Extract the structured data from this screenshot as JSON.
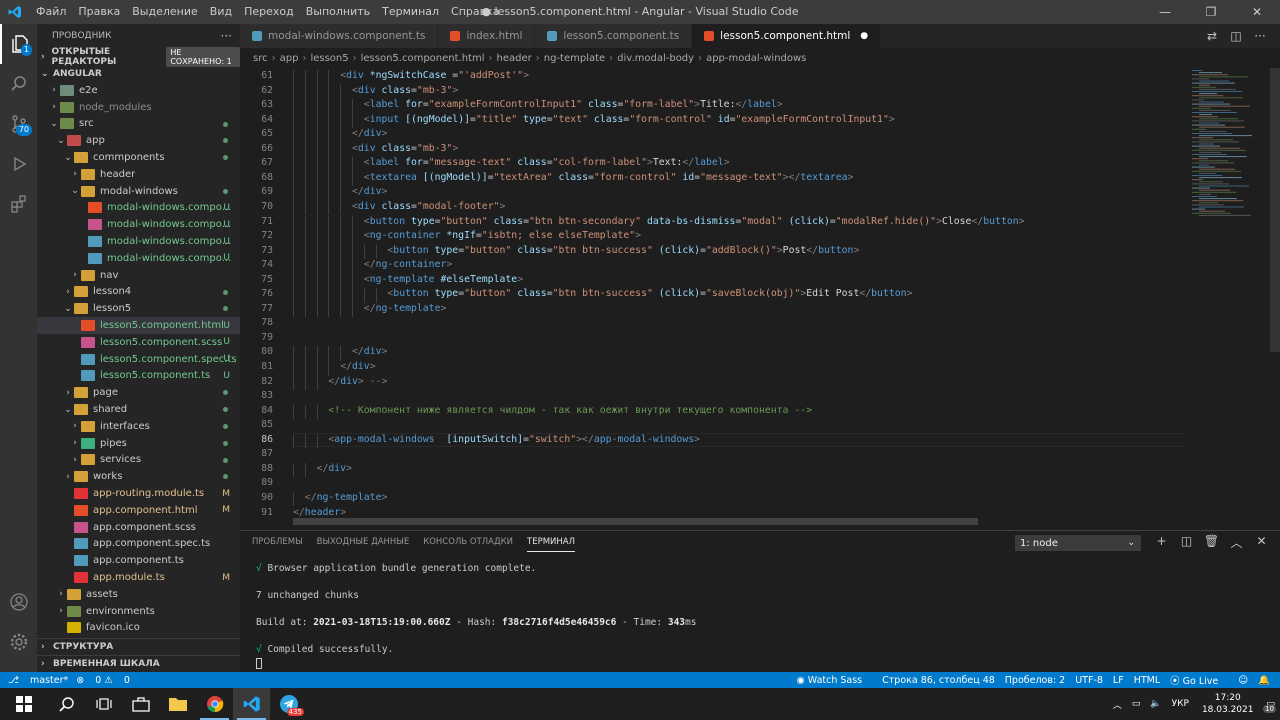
{
  "titlebar": {
    "menu": [
      "Файл",
      "Правка",
      "Выделение",
      "Вид",
      "Переход",
      "Выполнить",
      "Терминал",
      "Справка"
    ],
    "title": "● lesson5.component.html - Angular - Visual Studio Code"
  },
  "activity": {
    "badge_count": "70",
    "explorer_badge": "1"
  },
  "sidebar": {
    "header": "ПРОВОДНИК",
    "open_editors": "ОТКРЫТЫЕ РЕДАКТОРЫ",
    "unsaved": "НЕ СОХРАНЕНО: 1",
    "root": "ANGULAR",
    "items": [
      {
        "label": "e2e",
        "indent": 1,
        "chev": "›",
        "icon": "#6f8b7a",
        "status": ""
      },
      {
        "label": "node_modules",
        "indent": 1,
        "chev": "›",
        "icon": "#6f8b4a",
        "status": "",
        "dim": true
      },
      {
        "label": "src",
        "indent": 1,
        "chev": "⌄",
        "icon": "#6f8b4a",
        "status": "dot"
      },
      {
        "label": "app",
        "indent": 2,
        "chev": "⌄",
        "icon": "#c14b4b",
        "status": "dot"
      },
      {
        "label": "commponents",
        "indent": 3,
        "chev": "⌄",
        "icon": "#d4a038",
        "status": "dot"
      },
      {
        "label": "header",
        "indent": 4,
        "chev": "›",
        "icon": "#d4a038",
        "status": ""
      },
      {
        "label": "modal-windows",
        "indent": 4,
        "chev": "⌄",
        "icon": "#d4a038",
        "status": "dot"
      },
      {
        "label": "modal-windows.compo...",
        "indent": 5,
        "chev": "",
        "icon": "#e44d26",
        "status": "U"
      },
      {
        "label": "modal-windows.compo...",
        "indent": 5,
        "chev": "",
        "icon": "#c6538c",
        "status": "U"
      },
      {
        "label": "modal-windows.compo...",
        "indent": 5,
        "chev": "",
        "icon": "#519aba",
        "status": "U"
      },
      {
        "label": "modal-windows.compo...",
        "indent": 5,
        "chev": "",
        "icon": "#519aba",
        "status": "U"
      },
      {
        "label": "nav",
        "indent": 4,
        "chev": "›",
        "icon": "#d4a038",
        "status": ""
      },
      {
        "label": "lesson4",
        "indent": 3,
        "chev": "›",
        "icon": "#d4a038",
        "status": "dot"
      },
      {
        "label": "lesson5",
        "indent": 3,
        "chev": "⌄",
        "icon": "#d4a038",
        "status": "dot"
      },
      {
        "label": "lesson5.component.html",
        "indent": 4,
        "chev": "",
        "icon": "#e44d26",
        "status": "U",
        "sel": true
      },
      {
        "label": "lesson5.component.scss",
        "indent": 4,
        "chev": "",
        "icon": "#c6538c",
        "status": "U"
      },
      {
        "label": "lesson5.component.spec.ts",
        "indent": 4,
        "chev": "",
        "icon": "#519aba",
        "status": "U"
      },
      {
        "label": "lesson5.component.ts",
        "indent": 4,
        "chev": "",
        "icon": "#519aba",
        "status": "U"
      },
      {
        "label": "page",
        "indent": 3,
        "chev": "›",
        "icon": "#d4a038",
        "status": "dot"
      },
      {
        "label": "shared",
        "indent": 3,
        "chev": "⌄",
        "icon": "#d4a038",
        "status": "dot"
      },
      {
        "label": "interfaces",
        "indent": 4,
        "chev": "›",
        "icon": "#d4a038",
        "status": "dot"
      },
      {
        "label": "pipes",
        "indent": 4,
        "chev": "›",
        "icon": "#3fb07f",
        "status": "dot"
      },
      {
        "label": "services",
        "indent": 4,
        "chev": "›",
        "icon": "#d4a038",
        "status": "dot"
      },
      {
        "label": "works",
        "indent": 3,
        "chev": "›",
        "icon": "#d4a038",
        "status": "dot"
      },
      {
        "label": "app-routing.module.ts",
        "indent": 3,
        "chev": "",
        "icon": "#e23237",
        "status": "M"
      },
      {
        "label": "app.component.html",
        "indent": 3,
        "chev": "",
        "icon": "#e44d26",
        "status": "M"
      },
      {
        "label": "app.component.scss",
        "indent": 3,
        "chev": "",
        "icon": "#c6538c",
        "status": ""
      },
      {
        "label": "app.component.spec.ts",
        "indent": 3,
        "chev": "",
        "icon": "#519aba",
        "status": ""
      },
      {
        "label": "app.component.ts",
        "indent": 3,
        "chev": "",
        "icon": "#519aba",
        "status": ""
      },
      {
        "label": "app.module.ts",
        "indent": 3,
        "chev": "",
        "icon": "#e23237",
        "status": "M"
      },
      {
        "label": "assets",
        "indent": 2,
        "chev": "›",
        "icon": "#d4a038",
        "status": ""
      },
      {
        "label": "environments",
        "indent": 2,
        "chev": "›",
        "icon": "#6f8b4a",
        "status": ""
      },
      {
        "label": "favicon.ico",
        "indent": 2,
        "chev": "",
        "icon": "#d4b000",
        "status": ""
      }
    ],
    "outline": "СТРУКТУРА",
    "timeline": "ВРЕМЕННАЯ ШКАЛА"
  },
  "tabs": [
    {
      "label": "modal-windows.component.ts",
      "icon": "#519aba",
      "active": false
    },
    {
      "label": "index.html",
      "icon": "#e44d26",
      "active": false
    },
    {
      "label": "lesson5.component.ts",
      "icon": "#519aba",
      "active": false
    },
    {
      "label": "lesson5.component.html",
      "icon": "#e44d26",
      "active": true
    }
  ],
  "breadcrumb": [
    "src",
    "app",
    "lesson5",
    "lesson5.component.html",
    "header",
    "ng-template",
    "div.modal-body",
    "app-modal-windows"
  ],
  "code": {
    "current_line": 86,
    "lines": [
      {
        "n": 61,
        "i": 3,
        "h": "<span class='p'>&lt;</span><span class='t'>div</span> <span class='a'>*ngSwitchCase</span> <span class='w'>=</span><span class='s'>\"'addPost'\"</span><span class='p'>&gt;</span>"
      },
      {
        "n": 62,
        "i": 4,
        "h": "<span class='p'>&lt;</span><span class='t'>div</span> <span class='a'>class</span><span class='w'>=</span><span class='s'>\"mb-3\"</span><span class='p'>&gt;</span>"
      },
      {
        "n": 63,
        "i": 5,
        "h": "<span class='p'>&lt;</span><span class='t'>label</span> <span class='a'>for</span><span class='w'>=</span><span class='s'>\"exampleFormControlInput1\"</span> <span class='a'>class</span><span class='w'>=</span><span class='s'>\"form-label\"</span><span class='p'>&gt;</span><span class='w'>Title:</span><span class='p'>&lt;/</span><span class='t'>label</span><span class='p'>&gt;</span>"
      },
      {
        "n": 64,
        "i": 5,
        "h": "<span class='p'>&lt;</span><span class='t'>input</span> <span class='a'>[(ngModel)]</span><span class='w'>=</span><span class='s'>\"title\"</span> <span class='a'>type</span><span class='w'>=</span><span class='s'>\"text\"</span> <span class='a'>class</span><span class='w'>=</span><span class='s'>\"form-control\"</span> <span class='a'>id</span><span class='w'>=</span><span class='s'>\"exampleFormControlInput1\"</span><span class='p'>&gt;</span>"
      },
      {
        "n": 65,
        "i": 4,
        "h": "<span class='p'>&lt;/</span><span class='t'>div</span><span class='p'>&gt;</span>"
      },
      {
        "n": 66,
        "i": 4,
        "h": "<span class='p'>&lt;</span><span class='t'>div</span> <span class='a'>class</span><span class='w'>=</span><span class='s'>\"mb-3\"</span><span class='p'>&gt;</span>"
      },
      {
        "n": 67,
        "i": 5,
        "h": "<span class='p'>&lt;</span><span class='t'>label</span> <span class='a'>for</span><span class='w'>=</span><span class='s'>\"message-text\"</span> <span class='a'>class</span><span class='w'>=</span><span class='s'>\"col-form-label\"</span><span class='p'>&gt;</span><span class='w'>Text:</span><span class='p'>&lt;/</span><span class='t'>label</span><span class='p'>&gt;</span>"
      },
      {
        "n": 68,
        "i": 5,
        "h": "<span class='p'>&lt;</span><span class='t'>textarea</span> <span class='a'>[(ngModel)]</span><span class='w'>=</span><span class='s'>\"textArea\"</span> <span class='a'>class</span><span class='w'>=</span><span class='s'>\"form-control\"</span> <span class='a'>id</span><span class='w'>=</span><span class='s'>\"message-text\"</span><span class='p'>&gt;&lt;/</span><span class='t'>textarea</span><span class='p'>&gt;</span>"
      },
      {
        "n": 69,
        "i": 4,
        "h": "<span class='p'>&lt;/</span><span class='t'>div</span><span class='p'>&gt;</span>"
      },
      {
        "n": 70,
        "i": 4,
        "h": "<span class='p'>&lt;</span><span class='t'>div</span> <span class='a'>class</span><span class='w'>=</span><span class='s'>\"modal-footer\"</span><span class='p'>&gt;</span>"
      },
      {
        "n": 71,
        "i": 5,
        "h": "<span class='p'>&lt;</span><span class='t'>button</span> <span class='a'>type</span><span class='w'>=</span><span class='s'>\"button\"</span> <span class='a'>class</span><span class='w'>=</span><span class='s'>\"btn btn-secondary\"</span> <span class='a'>data-bs-dismiss</span><span class='w'>=</span><span class='s'>\"modal\"</span> <span class='a'>(click)</span><span class='w'>=</span><span class='s'>\"modalRef.hide()\"</span><span class='p'>&gt;</span><span class='w'>Close</span><span class='p'>&lt;/</span><span class='t'>button</span><span class='p'>&gt;</span>"
      },
      {
        "n": 72,
        "i": 5,
        "h": "<span class='p'>&lt;</span><span class='t'>ng-container</span> <span class='a'>*ngIf</span><span class='w'>=</span><span class='s'>\"isbtn; else elseTemplate\"</span><span class='p'>&gt;</span>"
      },
      {
        "n": 73,
        "i": 7,
        "h": "<span class='p'>&lt;</span><span class='t'>button</span> <span class='a'>type</span><span class='w'>=</span><span class='s'>\"button\"</span> <span class='a'>class</span><span class='w'>=</span><span class='s'>\"btn btn-success\"</span> <span class='a'>(click)</span><span class='w'>=</span><span class='s'>\"addBlock()\"</span><span class='p'>&gt;</span><span class='w'>Post</span><span class='p'>&lt;/</span><span class='t'>button</span><span class='p'>&gt;</span>"
      },
      {
        "n": 74,
        "i": 5,
        "h": "<span class='p'>&lt;/</span><span class='t'>ng-container</span><span class='p'>&gt;</span>"
      },
      {
        "n": 75,
        "i": 5,
        "h": "<span class='p'>&lt;</span><span class='t'>ng-template</span> <span class='a'>#elseTemplate</span><span class='p'>&gt;</span>"
      },
      {
        "n": 76,
        "i": 7,
        "h": "<span class='p'>&lt;</span><span class='t'>button</span> <span class='a'>type</span><span class='w'>=</span><span class='s'>\"button\"</span> <span class='a'>class</span><span class='w'>=</span><span class='s'>\"btn btn-success\"</span> <span class='a'>(click)</span><span class='w'>=</span><span class='s'>\"saveBlock(obj)\"</span><span class='p'>&gt;</span><span class='w'>Edit Post</span><span class='p'>&lt;/</span><span class='t'>button</span><span class='p'>&gt;</span>"
      },
      {
        "n": 77,
        "i": 5,
        "h": "<span class='p'>&lt;/</span><span class='t'>ng-template</span><span class='p'>&gt;</span>"
      },
      {
        "n": 78,
        "i": 0,
        "h": ""
      },
      {
        "n": 79,
        "i": 0,
        "h": ""
      },
      {
        "n": 80,
        "i": 4,
        "h": "<span class='p'>&lt;/</span><span class='t'>div</span><span class='p'>&gt;</span>"
      },
      {
        "n": 81,
        "i": 3,
        "h": "<span class='p'>&lt;/</span><span class='t'>div</span><span class='p'>&gt;</span>"
      },
      {
        "n": 82,
        "i": 2,
        "h": "<span class='p'>&lt;/</span><span class='t'>div</span><span class='p'>&gt; --&gt;</span>"
      },
      {
        "n": 83,
        "i": 0,
        "h": ""
      },
      {
        "n": 84,
        "i": 2,
        "h": "<span style='color:#6a9955'>&lt;!-- Компонент ниже является чилдом - так как оежит внутри текущего компонента --&gt;</span>"
      },
      {
        "n": 85,
        "i": 0,
        "h": ""
      },
      {
        "n": 86,
        "i": 2,
        "h": "<span class='p'>&lt;</span><span class='t'>app-modal-windows</span>  <span class='a'>[inputSwitch]</span><span class='w'>=</span><span class='s'>\"switch\"</span><span class='p'>&gt;&lt;/</span><span class='t'>app-modal-windows</span><span class='p'>&gt;</span>"
      },
      {
        "n": 87,
        "i": 0,
        "h": ""
      },
      {
        "n": 88,
        "i": 1,
        "h": "<span class='p'>&lt;/</span><span class='t'>div</span><span class='p'>&gt;</span>"
      },
      {
        "n": 89,
        "i": 0,
        "h": ""
      },
      {
        "n": 90,
        "i": 0,
        "h": "<span class='p'>&lt;/</span><span class='t'>ng-template</span><span class='p'>&gt;</span>"
      },
      {
        "n": 91,
        "i": -1,
        "h": "<span class='p'>&lt;/</span><span class='t'>header</span><span class='p'>&gt;</span>"
      }
    ]
  },
  "panel": {
    "tabs": [
      "ПРОБЛЕМЫ",
      "ВЫХОДНЫЕ ДАННЫЕ",
      "КОНСОЛЬ ОТЛАДКИ",
      "ТЕРМИНАЛ"
    ],
    "active_tab": 3,
    "terminal_select": "1: node",
    "lines": [
      {
        "h": "<span class='ok'>√</span> Browser application bundle generation complete."
      },
      {
        "h": ""
      },
      {
        "h": "7 unchanged chunks"
      },
      {
        "h": ""
      },
      {
        "h": "Build at: <b>2021-03-18T15:19:00.660Z</b> - Hash: <b>f38c2716f4d5e46459c6</b> - Time: <b>343</b>ms"
      },
      {
        "h": ""
      },
      {
        "h": "<span class='ok'>√</span> Compiled successfully."
      }
    ]
  },
  "status": {
    "branch": "master*",
    "errors": "0",
    "warnings": "0",
    "watch_sass": "Watch Sass",
    "position": "Строка 86, столбец 48",
    "spaces": "Пробелов: 2",
    "encoding": "UTF-8",
    "eol": "LF",
    "language": "HTML",
    "golive": "Go Live"
  },
  "taskbar": {
    "lang": "УКР",
    "time": "17:20",
    "date": "18.03.2021",
    "notif": "10",
    "telegram_badge": "435"
  }
}
